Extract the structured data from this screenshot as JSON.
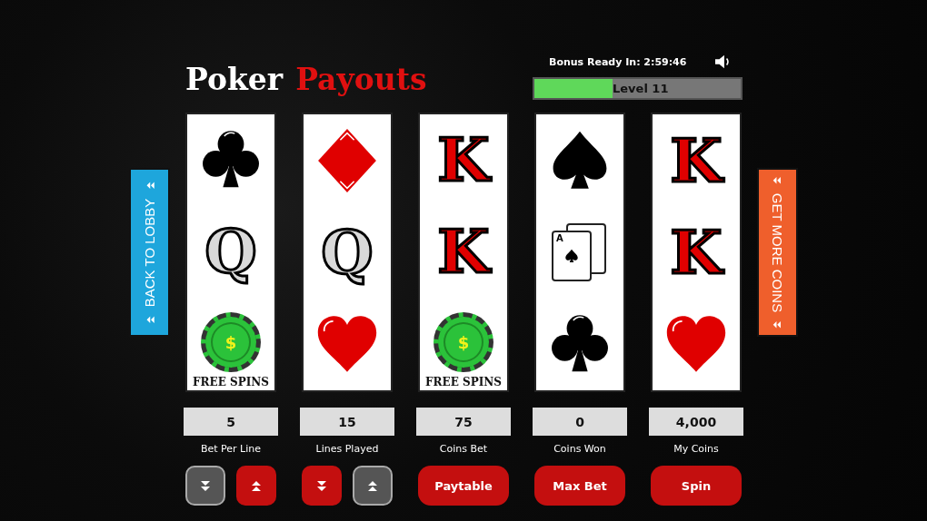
{
  "header": {
    "title": [
      {
        "text": "Poker",
        "accent": false
      },
      {
        "text": "Payouts",
        "accent": true
      }
    ],
    "bonus": "Bonus Ready In: 2:59:46",
    "level_bar": {
      "label": "Level 11",
      "level": 0.38
    }
  },
  "side_buttons": {
    "left": "BACK TO LOBBY",
    "right": "GET MORE COINS"
  },
  "reels": [
    {
      "symbols": [
        {
          "kind": "club"
        },
        {
          "kind": "letter",
          "text": "Q",
          "color": "#d9d9d9"
        },
        {
          "kind": "chip",
          "sign": "$",
          "label": "FREE SPINS"
        }
      ]
    },
    {
      "symbols": [
        {
          "kind": "diamond"
        },
        {
          "kind": "letter",
          "text": "Q",
          "color": "#d9d9d9"
        },
        {
          "kind": "heart"
        }
      ]
    },
    {
      "symbols": [
        {
          "kind": "letter",
          "text": "K",
          "color": "#e00000"
        },
        {
          "kind": "letter",
          "text": "K",
          "color": "#e00000"
        },
        {
          "kind": "chip",
          "sign": "$",
          "label": "FREE SPINS"
        }
      ]
    },
    {
      "symbols": [
        {
          "kind": "spade"
        },
        {
          "kind": "cards",
          "rank": "A"
        },
        {
          "kind": "club"
        }
      ]
    },
    {
      "symbols": [
        {
          "kind": "letter",
          "text": "K",
          "color": "#e00000"
        },
        {
          "kind": "letter",
          "text": "K",
          "color": "#e00000"
        },
        {
          "kind": "heart"
        }
      ]
    }
  ],
  "stats": [
    {
      "value": "5",
      "label": "Bet Per Line"
    },
    {
      "value": "15",
      "label": "Lines Played"
    },
    {
      "value": "75",
      "label": "Coins Bet"
    },
    {
      "value": "0",
      "label": "Coins Won"
    },
    {
      "value": "4,000",
      "label": "My Coins"
    }
  ],
  "controls": [
    {
      "kind": "stepper",
      "buttons": [
        {
          "kind": "down",
          "disabled": true
        },
        {
          "kind": "up",
          "disabled": false
        }
      ]
    },
    {
      "kind": "stepper",
      "buttons": [
        {
          "kind": "down",
          "disabled": false
        },
        {
          "kind": "up",
          "disabled": true
        }
      ]
    },
    {
      "kind": "button",
      "label": "Paytable"
    },
    {
      "kind": "button",
      "label": "Max Bet"
    },
    {
      "kind": "button",
      "label": "Spin"
    }
  ]
}
